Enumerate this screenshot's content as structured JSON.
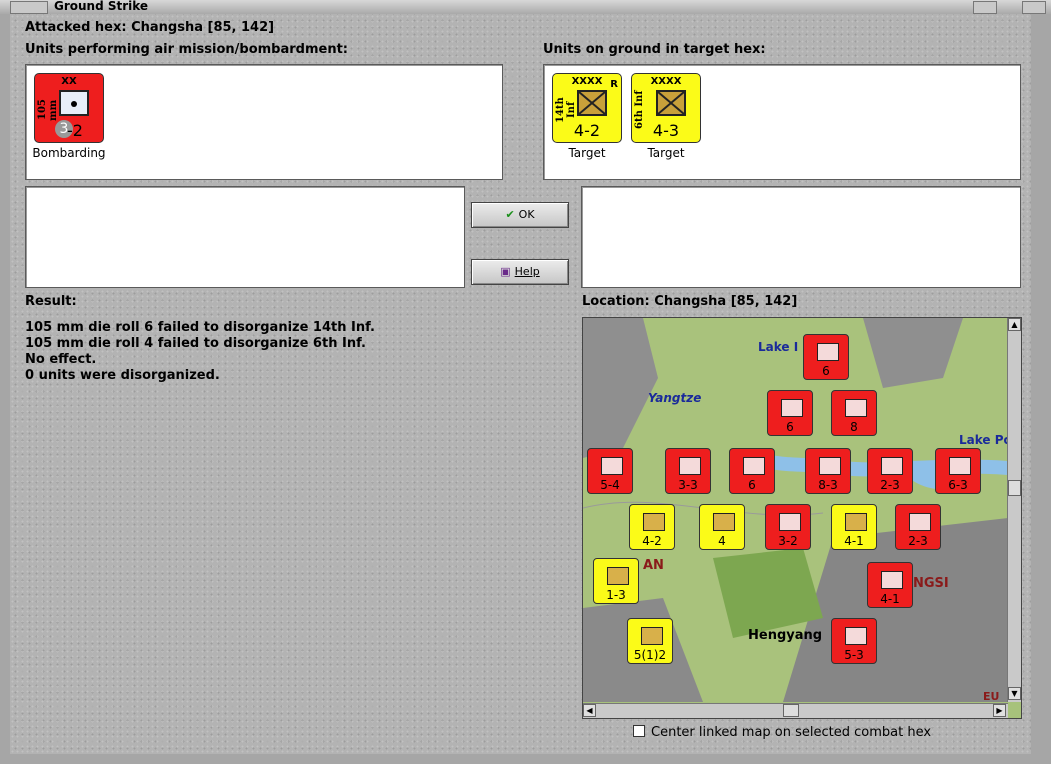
{
  "window": {
    "title": "Ground Strike"
  },
  "dialog": {
    "attacked_hex": "Attacked hex: Changsha  [85, 142]",
    "air_units_label": "Units performing air mission/bombardment:",
    "ground_units_label": "Units on ground in target hex:",
    "air_units": [
      {
        "size": "XX",
        "name": "105 mm",
        "strength": "3-2",
        "caption": "Bombarding",
        "color": "#ee1e1e"
      }
    ],
    "ground_units": [
      {
        "size": "XXXX",
        "name": "14th Inf",
        "strength": "4-2",
        "flag": "R",
        "caption": "Target",
        "color": "#fbfb18"
      },
      {
        "size": "XXXX",
        "name": "6th Inf",
        "strength": "4-3",
        "flag": "",
        "caption": "Target",
        "color": "#fbfb18"
      }
    ],
    "ok_button": "OK",
    "help_button": "Help",
    "result_label": "Result:",
    "result_lines": [
      "105 mm die roll 6 failed to disorganize 14th Inf.",
      "105 mm die roll 4 failed to disorganize 6th Inf.",
      "No effect.",
      "0 units were disorganized."
    ],
    "location_label": "Location:  Changsha  [85, 142]",
    "center_checkbox_label": "Center linked map on selected combat hex",
    "center_checkbox_checked": false
  },
  "map": {
    "place_labels": [
      "Lake I",
      "Yangtze",
      "Lake Poy",
      "Hengyang",
      "NGSI",
      "AN",
      "EU"
    ],
    "counters": [
      {
        "color": "red",
        "strength": "5-4"
      },
      {
        "color": "red",
        "strength": "3-3"
      },
      {
        "color": "red",
        "strength": "6"
      },
      {
        "color": "red",
        "strength": "8-3"
      },
      {
        "color": "red",
        "strength": "2-3"
      },
      {
        "color": "red",
        "strength": "6-3"
      },
      {
        "color": "yellow",
        "strength": "4-2"
      },
      {
        "color": "yellow",
        "strength": "4"
      },
      {
        "color": "red",
        "strength": "3-2"
      },
      {
        "color": "yellow",
        "strength": "4-1"
      },
      {
        "color": "red",
        "strength": "2-3"
      },
      {
        "color": "yellow",
        "strength": "1-3"
      },
      {
        "color": "red",
        "strength": "4-1"
      },
      {
        "color": "yellow",
        "strength": "5(1)2"
      },
      {
        "color": "red",
        "strength": "5-3"
      },
      {
        "color": "red",
        "strength": "6"
      },
      {
        "color": "red",
        "strength": "8"
      },
      {
        "color": "red",
        "strength": "6"
      }
    ]
  }
}
